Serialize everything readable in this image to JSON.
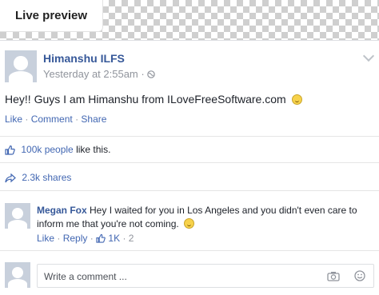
{
  "preview": {
    "tab_label": "Live preview"
  },
  "post": {
    "author": "Himanshu ILFS",
    "time": "Yesterday at 2:55am",
    "separator": "·",
    "text": "Hey!! Guys I am Himanshu from ILoveFreeSoftware.com",
    "actions": {
      "like": "Like",
      "comment": "Comment",
      "share": "Share",
      "sep": "·"
    }
  },
  "likes": {
    "count": "100k people",
    "suffix": "like this."
  },
  "shares": {
    "label": "2.3k shares"
  },
  "comment": {
    "author": "Megan Fox",
    "text": "Hey I waited for you in Los Angeles and you didn't even care to inform me that you're not coming.",
    "actions": {
      "like": "Like",
      "reply": "Reply",
      "like_count": "1K",
      "reply_count": "2",
      "sep": "·"
    }
  },
  "composer": {
    "placeholder": "Write a comment ..."
  },
  "icons": {
    "globe": "globe-icon",
    "thumb": "thumbs-up-icon",
    "share": "share-arrow-icon",
    "camera": "camera-icon",
    "emoji": "emoji-icon",
    "chevron": "chevron-down-icon"
  },
  "colors": {
    "link": "#4267b2",
    "author": "#365899",
    "muted": "#90949c",
    "avatar": "#c8d0dc"
  }
}
